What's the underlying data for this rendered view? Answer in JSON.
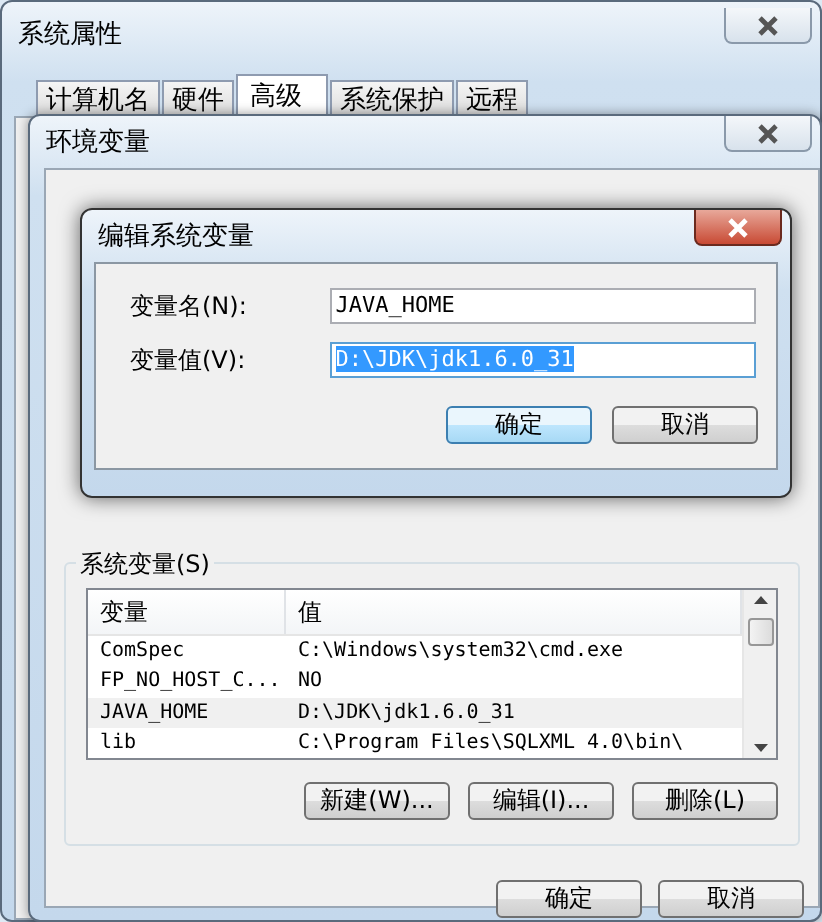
{
  "system_properties": {
    "title": "系统属性",
    "tabs": [
      {
        "label": "计算机名",
        "selected": false
      },
      {
        "label": "硬件",
        "selected": false
      },
      {
        "label": "高级",
        "selected": true
      },
      {
        "label": "系统保护",
        "selected": false
      },
      {
        "label": "远程",
        "selected": false
      }
    ]
  },
  "environment_variables": {
    "title": "环境变量",
    "system_variables": {
      "label": "系统变量(S)",
      "columns": [
        "变量",
        "值"
      ],
      "rows": [
        {
          "name": "ComSpec",
          "value": "C:\\Windows\\system32\\cmd.exe",
          "selected": false
        },
        {
          "name": "FP_NO_HOST_C...",
          "value": "NO",
          "selected": false
        },
        {
          "name": "JAVA_HOME",
          "value": "D:\\JDK\\jdk1.6.0_31",
          "selected": true
        },
        {
          "name": "lib",
          "value": "C:\\Program Files\\SQLXML 4.0\\bin\\",
          "selected": false
        }
      ],
      "buttons": [
        "新建(W)...",
        "编辑(I)...",
        "删除(L)"
      ]
    },
    "buttons": [
      "确定",
      "取消"
    ]
  },
  "edit_dialog": {
    "title": "编辑系统变量",
    "fields": [
      {
        "label": "变量名(N):",
        "value": "JAVA_HOME",
        "selected": false
      },
      {
        "label": "变量值(V):",
        "value": "D:\\JDK\\jdk1.6.0_31",
        "selected": true
      }
    ],
    "buttons": [
      {
        "label": "确定",
        "default": true
      },
      {
        "label": "取消",
        "default": false
      }
    ]
  }
}
